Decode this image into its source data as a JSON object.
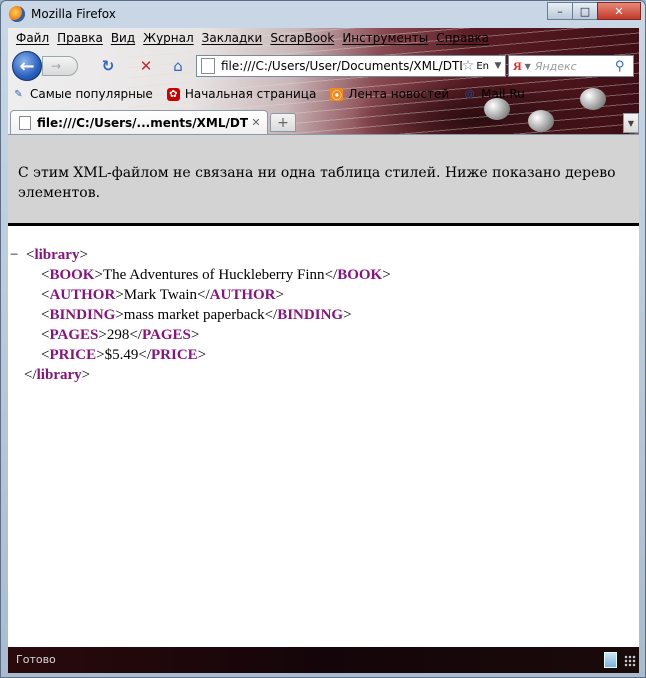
{
  "window": {
    "title": "Mozilla Firefox",
    "minimize": "–",
    "maximize": "□",
    "close": "✕"
  },
  "menu": [
    "Файл",
    "Правка",
    "Вид",
    "Журнал",
    "Закладки",
    "ScrapBook",
    "Инструменты",
    "Справка"
  ],
  "nav": {
    "url": "file:///C:/Users/User/Documents/XML/DTD.xml",
    "lang_icon": "En",
    "search_engine": "Я",
    "search_placeholder": "Яндекс"
  },
  "bookmarks": [
    "Самые популярные",
    "Начальная страница",
    "Лента новостей",
    "Mail.Ru"
  ],
  "tab": {
    "label": "file:///C:/Users/...ments/XML/DTD.xml"
  },
  "content": {
    "notice": "С этим XML-файлом не связана ни одна таблица стилей. Ниже показано дерево элементов.",
    "tree": {
      "collapse": "−",
      "root_tag": "library",
      "children": [
        {
          "tag": "BOOK",
          "text": "The Adventures of Huckleberry Finn"
        },
        {
          "tag": "AUTHOR",
          "text": "Mark Twain"
        },
        {
          "tag": "BINDING",
          "text": "mass market paperback"
        },
        {
          "tag": "PAGES",
          "text": "298"
        },
        {
          "tag": "PRICE",
          "text": "$5.49"
        }
      ]
    }
  },
  "status": {
    "text": "Готово"
  },
  "colors": {
    "tag": "#881280",
    "header_bg": "#d3d3d3"
  }
}
